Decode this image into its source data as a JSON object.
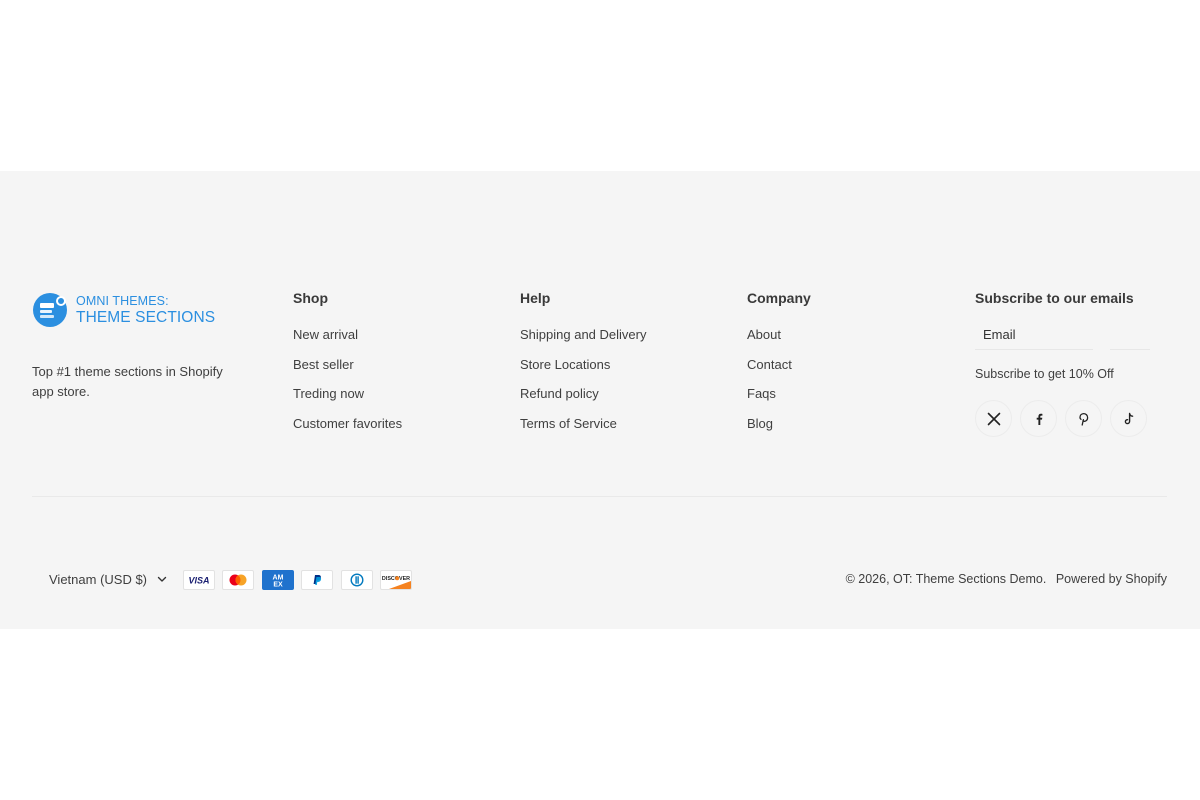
{
  "brand": {
    "logo_line1": "OMNI THEMES:",
    "logo_line2": "THEME SECTIONS",
    "description": "Top #1 theme sections in Shopify app store.",
    "color": "#2b8fe0"
  },
  "columns": {
    "shop": {
      "title": "Shop",
      "links": [
        "New arrival",
        "Best seller",
        "Treding now",
        "Customer favorites"
      ]
    },
    "help": {
      "title": "Help",
      "links": [
        "Shipping and Delivery",
        "Store Locations",
        "Refund policy",
        "Terms of Service"
      ]
    },
    "company": {
      "title": "Company",
      "links": [
        "About",
        "Contact",
        "Faqs",
        "Blog"
      ]
    }
  },
  "subscribe": {
    "title": "Subscribe to our emails",
    "email_placeholder": "Email",
    "note": "Subscribe to get 10% Off"
  },
  "socials": [
    "x-icon",
    "facebook-icon",
    "pinterest-icon",
    "tiktok-icon"
  ],
  "locale": {
    "label": "Vietnam (USD $)"
  },
  "payments": [
    "visa-icon",
    "mastercard-icon",
    "amex-icon",
    "paypal-icon",
    "diners-club-icon",
    "discover-icon"
  ],
  "footer_bottom": {
    "copyright": "© 2026, OT: Theme Sections Demo.",
    "powered_by": "Powered by Shopify"
  },
  "colors": {
    "footer_bg": "#f5f5f5",
    "page_bg": "#ffffff",
    "text": "#3f3f3f"
  }
}
